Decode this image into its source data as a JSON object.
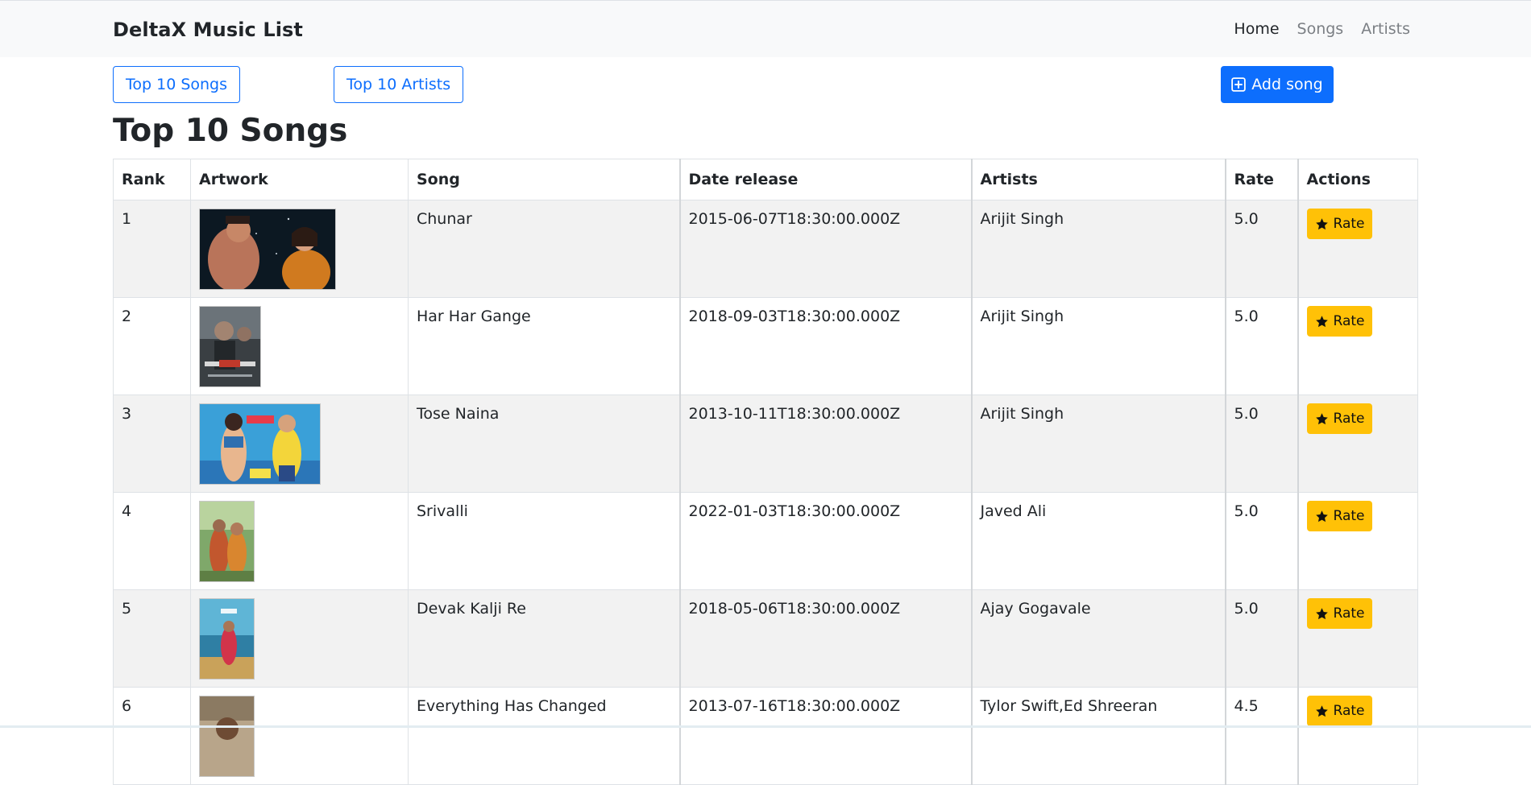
{
  "navbar": {
    "brand": "DeltaX Music List",
    "links": [
      {
        "label": "Home",
        "active": true
      },
      {
        "label": "Songs",
        "active": false
      },
      {
        "label": "Artists",
        "active": false
      }
    ]
  },
  "toolbar": {
    "top_songs_label": "Top 10 Songs",
    "top_artists_label": "Top 10 Artists",
    "add_song_label": "Add song",
    "add_song_icon": "plus-square-icon"
  },
  "page": {
    "title": "Top 10 Songs"
  },
  "table": {
    "columns": [
      "Rank",
      "Artwork",
      "Song",
      "Date release",
      "Artists",
      "Rate",
      "Actions"
    ],
    "rows": [
      {
        "rank": "1",
        "song": "Chunar",
        "date": "2015-06-07T18:30:00.000Z",
        "artists": "Arijit Singh",
        "rate": "5.0",
        "action": "Rate"
      },
      {
        "rank": "2",
        "song": "Har Har Gange",
        "date": "2018-09-03T18:30:00.000Z",
        "artists": "Arijit Singh",
        "rate": "5.0",
        "action": "Rate"
      },
      {
        "rank": "3",
        "song": "Tose Naina",
        "date": "2013-10-11T18:30:00.000Z",
        "artists": "Arijit Singh",
        "rate": "5.0",
        "action": "Rate"
      },
      {
        "rank": "4",
        "song": "Srivalli",
        "date": "2022-01-03T18:30:00.000Z",
        "artists": "Javed Ali",
        "rate": "5.0",
        "action": "Rate"
      },
      {
        "rank": "5",
        "song": "Devak Kalji Re",
        "date": "2018-05-06T18:30:00.000Z",
        "artists": "Ajay Gogavale",
        "rate": "5.0",
        "action": "Rate"
      },
      {
        "rank": "6",
        "song": "Everything Has Changed",
        "date": "2013-07-16T18:30:00.000Z",
        "artists": "Tylor Swift,Ed Shreeran",
        "rate": "4.5",
        "action": "Rate"
      }
    ]
  },
  "colors": {
    "primary": "#0d6efd",
    "warning": "#ffc107",
    "navbar_bg": "#f8f9fa",
    "stripe": "#f2f2f2"
  },
  "icons": {
    "rate": "star-icon",
    "add": "plus-square-icon"
  }
}
